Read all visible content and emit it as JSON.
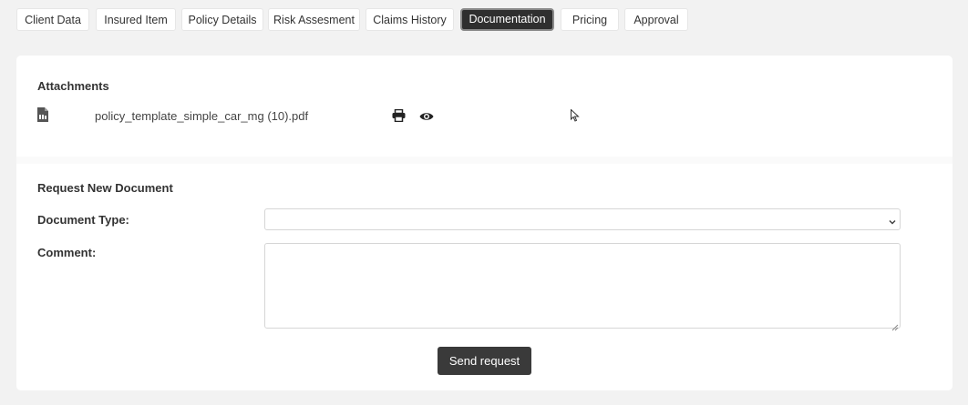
{
  "tabs": [
    {
      "label": "Client Data",
      "active": false
    },
    {
      "label": "Insured Item",
      "active": false
    },
    {
      "label": "Policy Details",
      "active": false
    },
    {
      "label": "Risk Assesment",
      "active": false
    },
    {
      "label": "Claims History",
      "active": false
    },
    {
      "label": "Documentation",
      "active": true
    },
    {
      "label": "Pricing",
      "active": false
    },
    {
      "label": "Approval",
      "active": false
    }
  ],
  "attachments": {
    "heading": "Attachments",
    "files": [
      {
        "name": "policy_template_simple_car_mg (10).pdf",
        "icon": "file-pdf-icon",
        "actions": [
          "print-icon",
          "eye-icon"
        ]
      }
    ]
  },
  "request": {
    "heading": "Request New Document",
    "document_type_label": "Document Type:",
    "document_type_value": "",
    "comment_label": "Comment:",
    "comment_value": "",
    "send_label": "Send request"
  },
  "colors": {
    "active_tab": "#2f2f2f",
    "button": "#3a3a3a",
    "background": "#f2f2f2"
  }
}
